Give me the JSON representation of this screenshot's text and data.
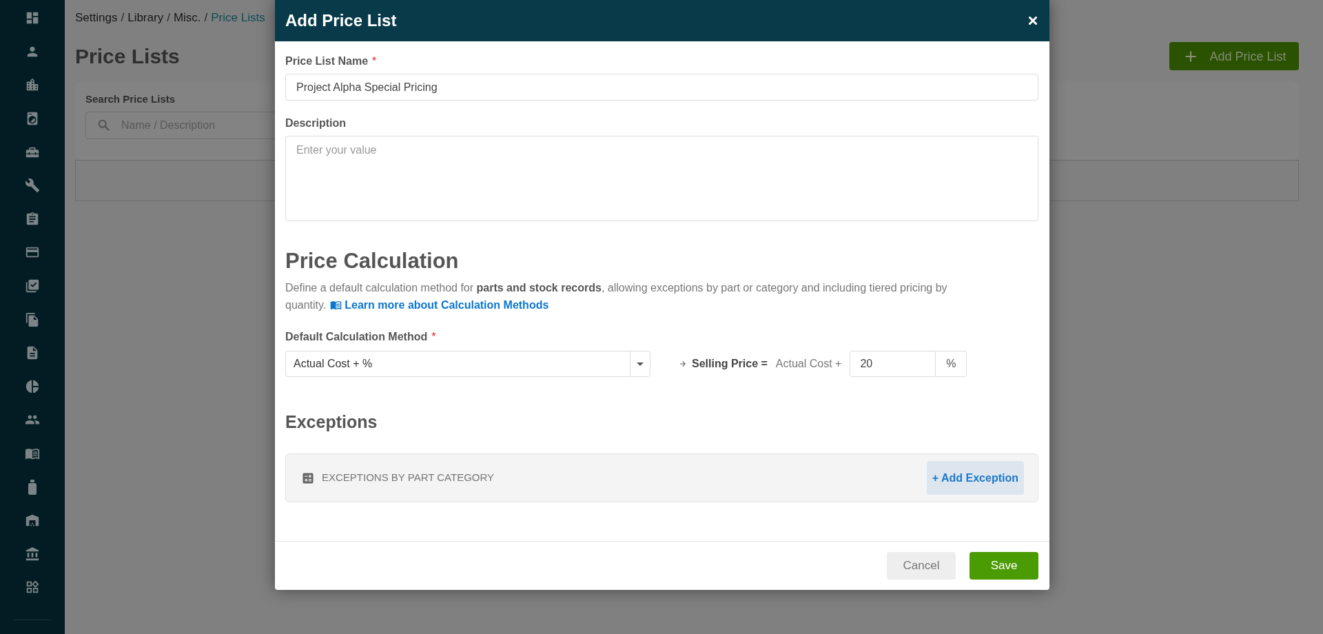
{
  "breadcrumb": {
    "separator": "/",
    "items": [
      {
        "label": "Settings",
        "current": false
      },
      {
        "label": "Library",
        "current": false
      },
      {
        "label": "Misc.",
        "current": false
      },
      {
        "label": "Price Lists",
        "current": true
      }
    ]
  },
  "page": {
    "title": "Price Lists",
    "add_button": "Add Price List",
    "search": {
      "label": "Search Price Lists",
      "placeholder": "Name / Description"
    }
  },
  "dialog": {
    "title": "Add Price List",
    "fields": [
      {
        "kind": "text",
        "label": "Price List Name",
        "required_mark": "*",
        "value": "Project Alpha Special Pricing"
      },
      {
        "kind": "textarea",
        "label": "Description",
        "placeholder": "Enter your value"
      }
    ],
    "price_calculation": {
      "heading": "Price Calculation",
      "intro": "Define a default calculation method for **parts and stock records**, allowing exceptions by part or category and including tiered pricing by quantity.",
      "learn_more_link": "Learn more about Calculation Methods",
      "method": {
        "label": "Default Calculation Method",
        "required_mark": "*",
        "value": "Actual Cost + %"
      },
      "formula": {
        "result": "Selling Price =",
        "base": "Actual Cost +",
        "value": "20",
        "unit": "%"
      }
    },
    "exceptions": {
      "heading": "Exceptions",
      "panel": {
        "title": "EXCEPTIONS BY PART CATEGORY",
        "button": "+ Add Exception"
      }
    },
    "footer": {
      "buttons": [
        {
          "kind": "secondary",
          "label": "Cancel"
        },
        {
          "kind": "primary",
          "label": "Save"
        }
      ]
    }
  }
}
